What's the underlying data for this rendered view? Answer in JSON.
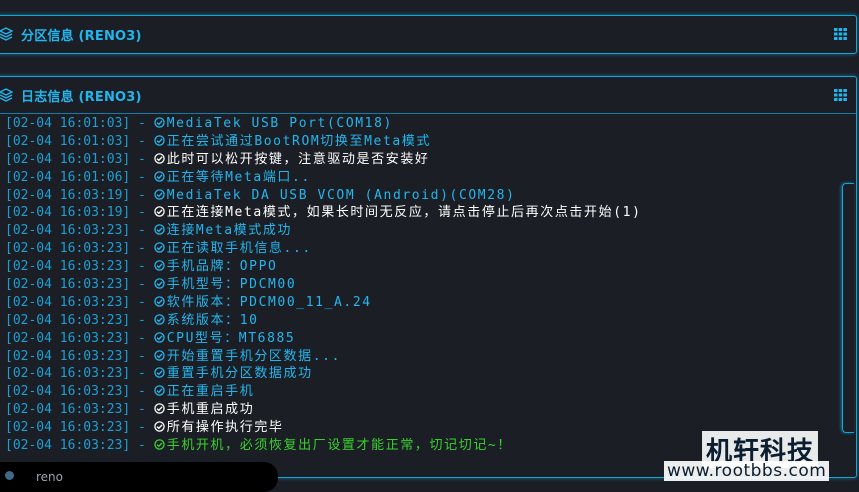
{
  "panels": {
    "partition": {
      "title": "分区信息 (RENO3)",
      "icon": "layers-icon",
      "action_icon": "grid-icon"
    },
    "log": {
      "title": "日志信息 (RENO3)",
      "icon": "layers-icon",
      "action_icon": "grid-icon"
    }
  },
  "colors": {
    "accent": "#0fa6d9",
    "timestamp": "#1d9fd3",
    "info": "#22b6ee",
    "notice": "#ffffff",
    "success": "#3bd12f"
  },
  "log_lines": [
    {
      "ts": "[02-04 16:01:03] -",
      "msg": "MediaTek USB Port(COM18)",
      "level": "info"
    },
    {
      "ts": "[02-04 16:01:03] -",
      "msg": "正在尝试通过BootROM切换至Meta模式",
      "level": "info"
    },
    {
      "ts": "[02-04 16:01:03] -",
      "msg": "此时可以松开按键，注意驱动是否安装好",
      "level": "notice"
    },
    {
      "ts": "[02-04 16:01:06] -",
      "msg": "正在等待Meta端口..",
      "level": "info"
    },
    {
      "ts": "[02-04 16:03:19] -",
      "msg": "MediaTek DA USB VCOM (Android)(COM28)",
      "level": "info"
    },
    {
      "ts": "[02-04 16:03:19] -",
      "msg": "正在连接Meta模式，如果长时间无反应，请点击停止后再次点击开始(1)",
      "level": "notice"
    },
    {
      "ts": "[02-04 16:03:23] -",
      "msg": "连接Meta模式成功",
      "level": "info"
    },
    {
      "ts": "[02-04 16:03:23] -",
      "msg": "正在读取手机信息...",
      "level": "info"
    },
    {
      "ts": "[02-04 16:03:23] -",
      "msg": "手机品牌：OPPO",
      "level": "info"
    },
    {
      "ts": "[02-04 16:03:23] -",
      "msg": "手机型号：PDCM00",
      "level": "info"
    },
    {
      "ts": "[02-04 16:03:23] -",
      "msg": "软件版本：PDCM00_11_A.24",
      "level": "info"
    },
    {
      "ts": "[02-04 16:03:23] -",
      "msg": "系统版本：10",
      "level": "info"
    },
    {
      "ts": "[02-04 16:03:23] -",
      "msg": "CPU型号：MT6885",
      "level": "info"
    },
    {
      "ts": "[02-04 16:03:23] -",
      "msg": "开始重置手机分区数据...",
      "level": "info"
    },
    {
      "ts": "[02-04 16:03:23] -",
      "msg": "重置手机分区数据成功",
      "level": "info"
    },
    {
      "ts": "[02-04 16:03:23] -",
      "msg": "正在重启手机",
      "level": "info"
    },
    {
      "ts": "[02-04 16:03:23] -",
      "msg": "手机重启成功",
      "level": "notice"
    },
    {
      "ts": "[02-04 16:03:23] -",
      "msg": "所有操作执行完毕",
      "level": "notice"
    },
    {
      "ts": "[02-04 16:03:23] -",
      "msg": "手机开机，必须恢复出厂设置才能正常，切记切记~！",
      "level": "success"
    }
  ],
  "bottom_tab": {
    "label": "reno"
  },
  "watermark": {
    "text_cn": "机轩科技",
    "url": "www.rootbbs.com"
  }
}
